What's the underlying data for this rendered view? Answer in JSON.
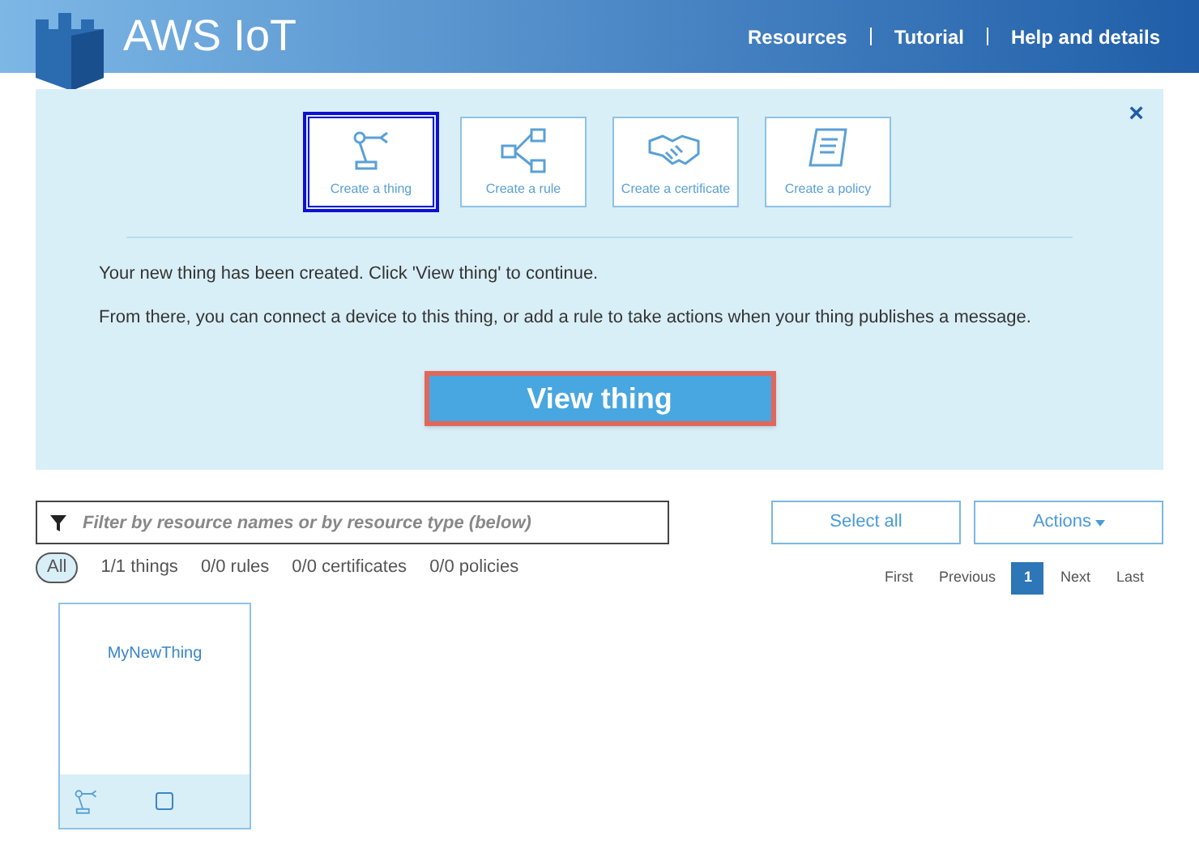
{
  "header": {
    "title": "AWS IoT",
    "nav": [
      "Resources",
      "Tutorial",
      "Help and details"
    ]
  },
  "wizard": {
    "close": "×",
    "steps": [
      {
        "label": "Create a thing",
        "kind": "thing",
        "selected": true
      },
      {
        "label": "Create a rule",
        "kind": "rule",
        "selected": false
      },
      {
        "label": "Create a certificate",
        "kind": "certificate",
        "selected": false
      },
      {
        "label": "Create a policy",
        "kind": "policy",
        "selected": false
      }
    ],
    "messages": [
      "Your new thing has been created. Click 'View thing' to continue.",
      "From there, you can connect a device to this thing, or add a rule to take actions when your thing publishes a message."
    ],
    "button": "View thing"
  },
  "filter": {
    "placeholder": "Filter by resource names or by resource type (below)"
  },
  "select_all": "Select all",
  "actions": "Actions",
  "counts": [
    {
      "label": "All",
      "selected": true
    },
    {
      "label": "1/1 things",
      "selected": false
    },
    {
      "label": "0/0 rules",
      "selected": false
    },
    {
      "label": "0/0 certificates",
      "selected": false
    },
    {
      "label": "0/0 policies",
      "selected": false
    }
  ],
  "pagination": [
    {
      "label": "First",
      "selected": false
    },
    {
      "label": "Previous",
      "selected": false
    },
    {
      "label": "1",
      "selected": true
    },
    {
      "label": "Next",
      "selected": false
    },
    {
      "label": "Last",
      "selected": false
    }
  ],
  "cards": [
    {
      "name": "MyNewThing",
      "checked": false
    }
  ]
}
